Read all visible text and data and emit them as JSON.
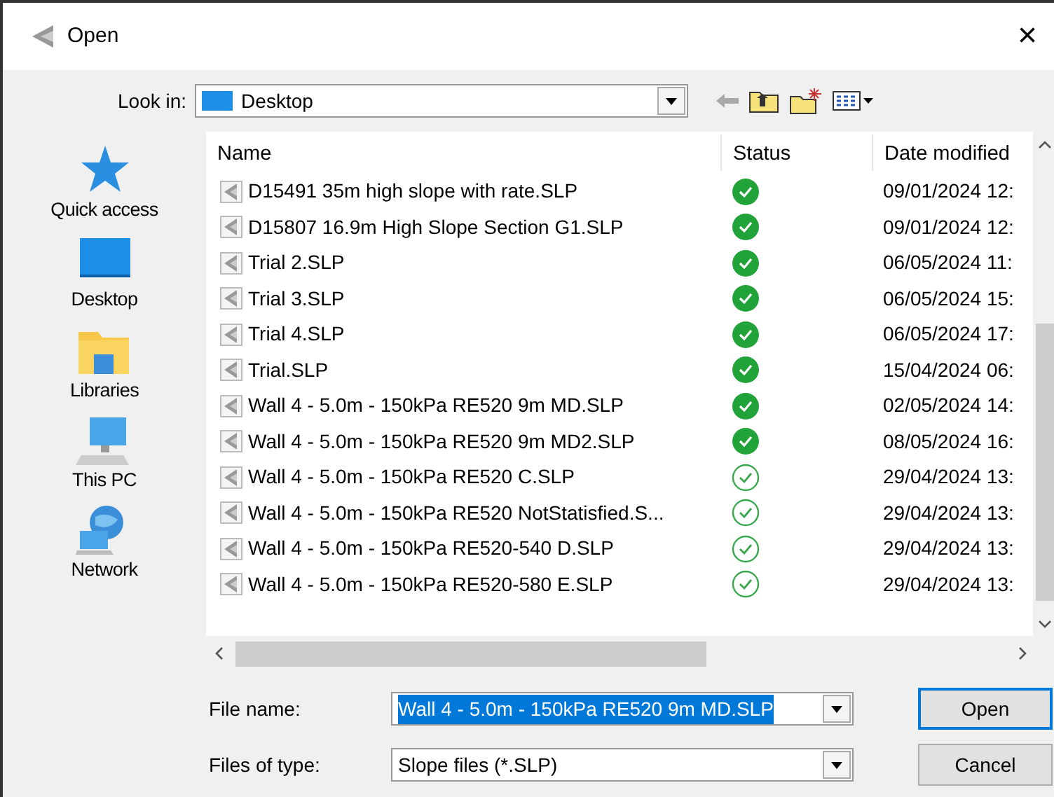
{
  "window": {
    "title": "Open",
    "close": "×"
  },
  "look_in": {
    "label": "Look in:",
    "value": "Desktop"
  },
  "places": [
    {
      "label": "Quick access",
      "kind": "star"
    },
    {
      "label": "Desktop",
      "kind": "desktop"
    },
    {
      "label": "Libraries",
      "kind": "folder"
    },
    {
      "label": "This PC",
      "kind": "pc"
    },
    {
      "label": "Network",
      "kind": "network"
    }
  ],
  "table": {
    "columns": [
      "Name",
      "Status",
      "Date modified"
    ],
    "rows": [
      {
        "name": "D15491 35m high slope with rate.SLP",
        "synced": true,
        "date": "09/01/2024 12:"
      },
      {
        "name": "D15807 16.9m High Slope Section G1.SLP",
        "synced": true,
        "date": "09/01/2024 12:"
      },
      {
        "name": "Trial 2.SLP",
        "synced": true,
        "date": "06/05/2024 11:"
      },
      {
        "name": "Trial 3.SLP",
        "synced": true,
        "date": "06/05/2024 15:"
      },
      {
        "name": "Trial 4.SLP",
        "synced": true,
        "date": "06/05/2024 17:"
      },
      {
        "name": "Trial.SLP",
        "synced": true,
        "date": "15/04/2024 06:"
      },
      {
        "name": "Wall 4 - 5.0m - 150kPa RE520 9m MD.SLP",
        "synced": true,
        "date": "02/05/2024 14:"
      },
      {
        "name": "Wall 4 - 5.0m - 150kPa RE520 9m MD2.SLP",
        "synced": true,
        "date": "08/05/2024 16:"
      },
      {
        "name": "Wall 4 - 5.0m - 150kPa RE520 C.SLP",
        "synced": false,
        "date": "29/04/2024 13:"
      },
      {
        "name": "Wall 4 - 5.0m - 150kPa RE520 NotStatisfied.S...",
        "synced": false,
        "date": "29/04/2024 13:"
      },
      {
        "name": "Wall 4 - 5.0m - 150kPa RE520-540 D.SLP",
        "synced": false,
        "date": "29/04/2024 13:"
      },
      {
        "name": "Wall 4 - 5.0m - 150kPa RE520-580 E.SLP",
        "synced": false,
        "date": "29/04/2024 13:"
      }
    ]
  },
  "file_name": {
    "label": "File name:",
    "value": "Wall 4 - 5.0m - 150kPa RE520 9m MD.SLP"
  },
  "file_type": {
    "label": "Files of type:",
    "value": "Slope files (*.SLP)"
  },
  "buttons": [
    "Open",
    "Cancel"
  ]
}
